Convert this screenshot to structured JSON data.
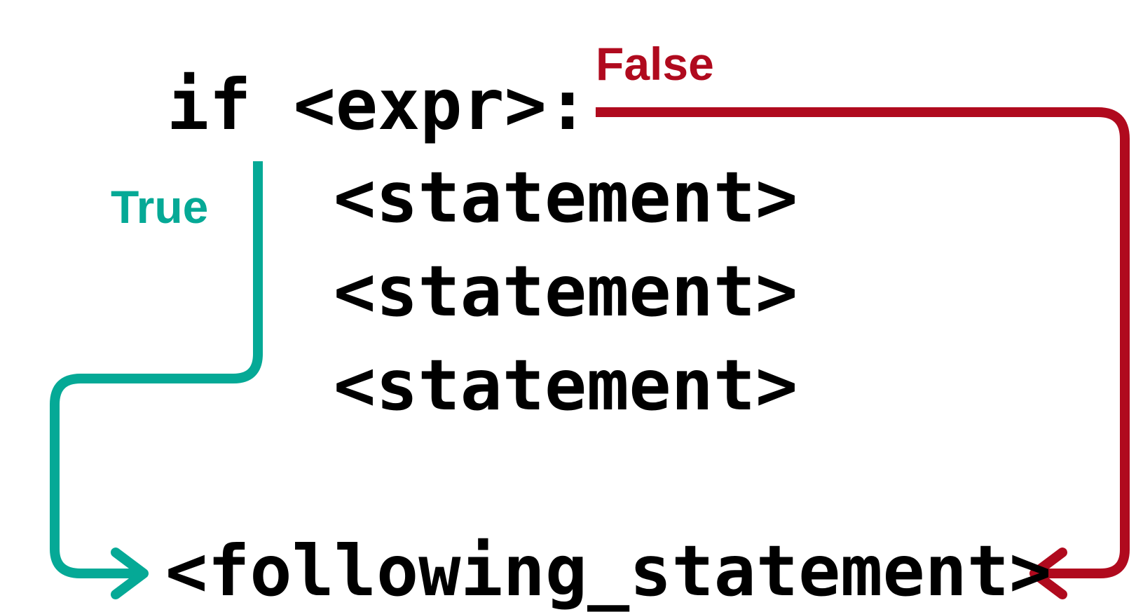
{
  "code": {
    "if_line": "if <expr>:",
    "statements": [
      "<statement>",
      "<statement>",
      "<statement>"
    ],
    "following": "<following_statement>"
  },
  "labels": {
    "true_label": "True",
    "false_label": "False"
  },
  "colors": {
    "true_path": "#05a996",
    "false_path": "#b00a1e",
    "code_text": "#000000"
  }
}
